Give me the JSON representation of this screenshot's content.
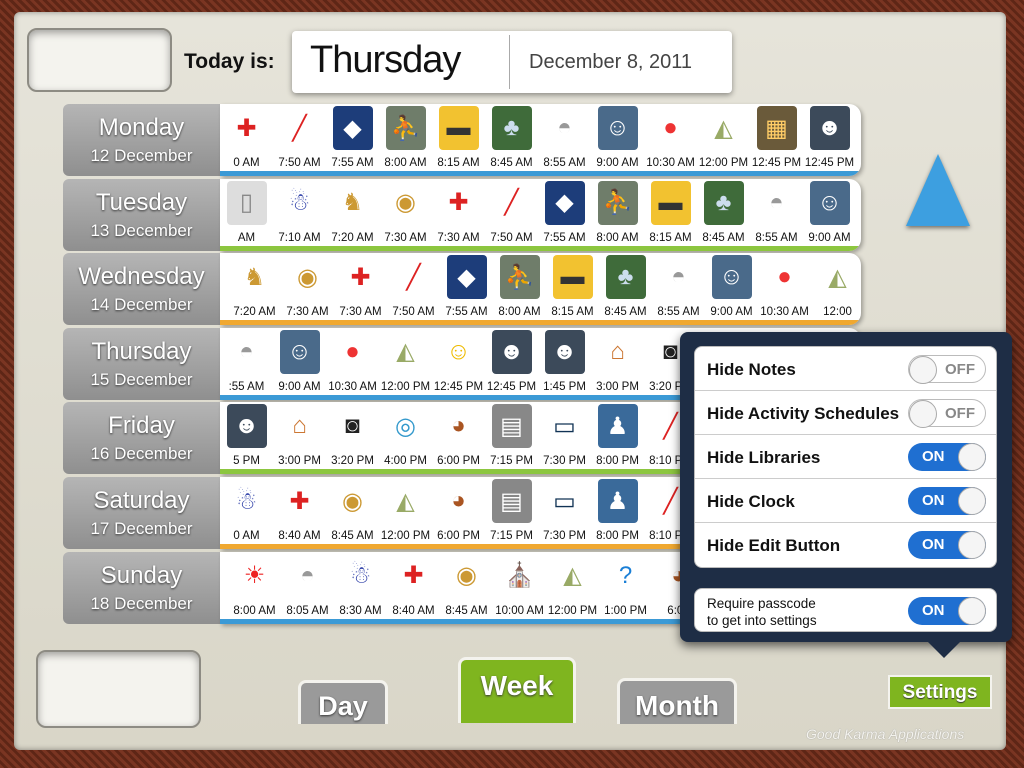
{
  "header": {
    "today_label": "Today is:",
    "day": "Thursday",
    "date": "December 8, 2011"
  },
  "days": [
    {
      "name": "Monday",
      "date": "12 December",
      "line": "#3b9ad6",
      "items": [
        [
          "pills",
          "0 AM"
        ],
        [
          "toothbrush",
          "7:50 AM"
        ],
        [
          "backpack",
          "7:55 AM"
        ],
        [
          "photo-walk",
          "8:00 AM"
        ],
        [
          "school-bus",
          "8:15 AM"
        ],
        [
          "photo-trees",
          "8:45 AM"
        ],
        [
          "toilet",
          "8:55 AM"
        ],
        [
          "photo-class",
          "9:00 AM"
        ],
        [
          "juice-apple",
          "10:30 AM"
        ],
        [
          "lunch",
          "12:00 PM"
        ],
        [
          "photo-gym",
          "12:45 PM"
        ],
        [
          "photo-group",
          "12:45 PM"
        ]
      ]
    },
    {
      "name": "Tuesday",
      "date": "13 December",
      "line": "#8cc63f",
      "items": [
        [
          "door",
          "AM"
        ],
        [
          "dressing",
          "7:10 AM"
        ],
        [
          "dog",
          "7:20 AM"
        ],
        [
          "breakfast",
          "7:30 AM"
        ],
        [
          "pills",
          "7:30 AM"
        ],
        [
          "toothbrush",
          "7:50 AM"
        ],
        [
          "backpack",
          "7:55 AM"
        ],
        [
          "photo-walk",
          "8:00 AM"
        ],
        [
          "school-bus",
          "8:15 AM"
        ],
        [
          "photo-trees",
          "8:45 AM"
        ],
        [
          "toilet",
          "8:55 AM"
        ],
        [
          "photo-class",
          "9:00 AM"
        ]
      ]
    },
    {
      "name": "Wednesday",
      "date": "14 December",
      "line": "#f0a830",
      "items": [
        [
          "dog",
          "7:20 AM"
        ],
        [
          "breakfast",
          "7:30 AM"
        ],
        [
          "pills",
          "7:30 AM"
        ],
        [
          "toothbrush",
          "7:50 AM"
        ],
        [
          "backpack",
          "7:55 AM"
        ],
        [
          "photo-walk",
          "8:00 AM"
        ],
        [
          "school-bus",
          "8:15 AM"
        ],
        [
          "photo-trees",
          "8:45 AM"
        ],
        [
          "toilet",
          "8:55 AM"
        ],
        [
          "photo-class",
          "9:00 AM"
        ],
        [
          "juice-apple",
          "10:30 AM"
        ],
        [
          "lunch",
          "12:00"
        ]
      ]
    },
    {
      "name": "Thursday",
      "date": "15 December",
      "line": "#3b9ad6",
      "items": [
        [
          "toilet",
          ":55 AM"
        ],
        [
          "photo-class",
          "9:00 AM"
        ],
        [
          "juice-apple",
          "10:30 AM"
        ],
        [
          "lunch",
          "12:00 PM"
        ],
        [
          "talk",
          "12:45 PM"
        ],
        [
          "photo-group",
          "12:45 PM"
        ],
        [
          "photo-group",
          "1:45 PM"
        ],
        [
          "house",
          "3:00 PM"
        ],
        [
          "game-controller",
          "3:20 PM"
        ]
      ]
    },
    {
      "name": "Friday",
      "date": "16 December",
      "line": "#8cc63f",
      "items": [
        [
          "photo-group",
          "5 PM"
        ],
        [
          "house",
          "3:00 PM"
        ],
        [
          "game-controller",
          "3:20 PM"
        ],
        [
          "dog-leash",
          "4:00 PM"
        ],
        [
          "dinner",
          "6:00 PM"
        ],
        [
          "dishwasher",
          "7:15 PM"
        ],
        [
          "tv",
          "7:30 PM"
        ],
        [
          "pajamas",
          "8:00 PM"
        ],
        [
          "toothbrush",
          "8:10 PM"
        ]
      ]
    },
    {
      "name": "Saturday",
      "date": "17 December",
      "line": "#f0a830",
      "items": [
        [
          "dressing",
          "0 AM"
        ],
        [
          "pills",
          "8:40 AM"
        ],
        [
          "breakfast",
          "8:45 AM"
        ],
        [
          "lunch",
          "12:00 PM"
        ],
        [
          "dinner",
          "6:00 PM"
        ],
        [
          "dishwasher",
          "7:15 PM"
        ],
        [
          "tv",
          "7:30 PM"
        ],
        [
          "pajamas",
          "8:00 PM"
        ],
        [
          "toothbrush",
          "8:10 PM"
        ]
      ]
    },
    {
      "name": "Sunday",
      "date": "18 December",
      "line": "#3b9ad6",
      "items": [
        [
          "wake-up",
          "8:00 AM"
        ],
        [
          "toilet",
          "8:05 AM"
        ],
        [
          "dressing",
          "8:30 AM"
        ],
        [
          "pills",
          "8:40 AM"
        ],
        [
          "breakfast",
          "8:45 AM"
        ],
        [
          "church",
          "10:00 AM"
        ],
        [
          "lunch",
          "12:00 PM"
        ],
        [
          "question",
          "1:00 PM"
        ],
        [
          "dinner",
          "6:00"
        ]
      ]
    }
  ],
  "tabs": {
    "day": "Day",
    "week": "Week",
    "month": "Month"
  },
  "settings_popover": {
    "options": [
      {
        "label": "Hide Notes",
        "state": "OFF"
      },
      {
        "label": "Hide Activity Schedules",
        "state": "OFF"
      },
      {
        "label": "Hide Libraries",
        "state": "ON"
      },
      {
        "label": "Hide Clock",
        "state": "ON"
      },
      {
        "label": "Hide Edit Button",
        "state": "ON"
      }
    ],
    "passcode": {
      "line1": "Require passcode",
      "line2": "to get into settings",
      "state": "ON"
    }
  },
  "settings_button": "Settings",
  "brand": "Good Karma Applications",
  "colors": {
    "accent_blue": "#3d9fe0",
    "settings_green": "#7fb51f",
    "popover": "#1e2d45"
  }
}
